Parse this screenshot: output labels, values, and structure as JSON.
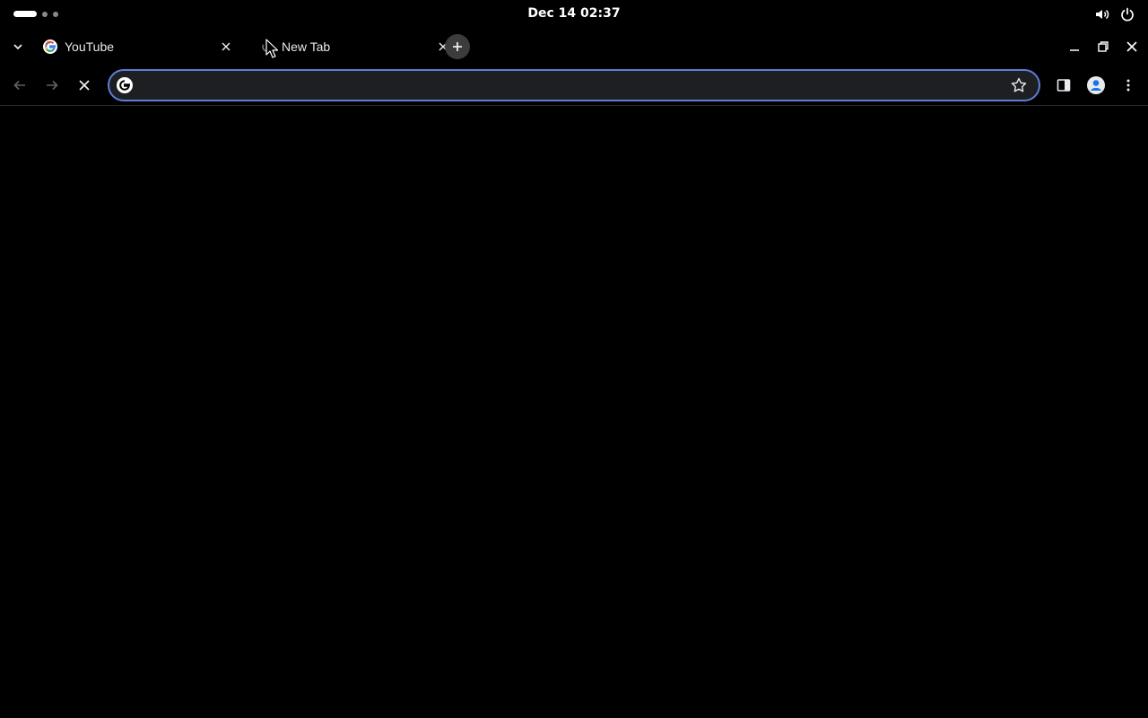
{
  "system_bar": {
    "clock": "Dec 14  02:37",
    "icons": [
      "volume-icon",
      "power-icon"
    ]
  },
  "tabs": [
    {
      "title": "YouTube",
      "favicon": "google-g-icon",
      "active": false
    },
    {
      "title": "New Tab",
      "favicon": "loading-icon",
      "active": true
    }
  ],
  "omnibox": {
    "value": "",
    "placeholder": ""
  },
  "colors": {
    "background": "#000000",
    "omnibox_bg": "#1e1f22",
    "omnibox_focus_border": "#5b7fd8",
    "text": "#e8eaed"
  }
}
